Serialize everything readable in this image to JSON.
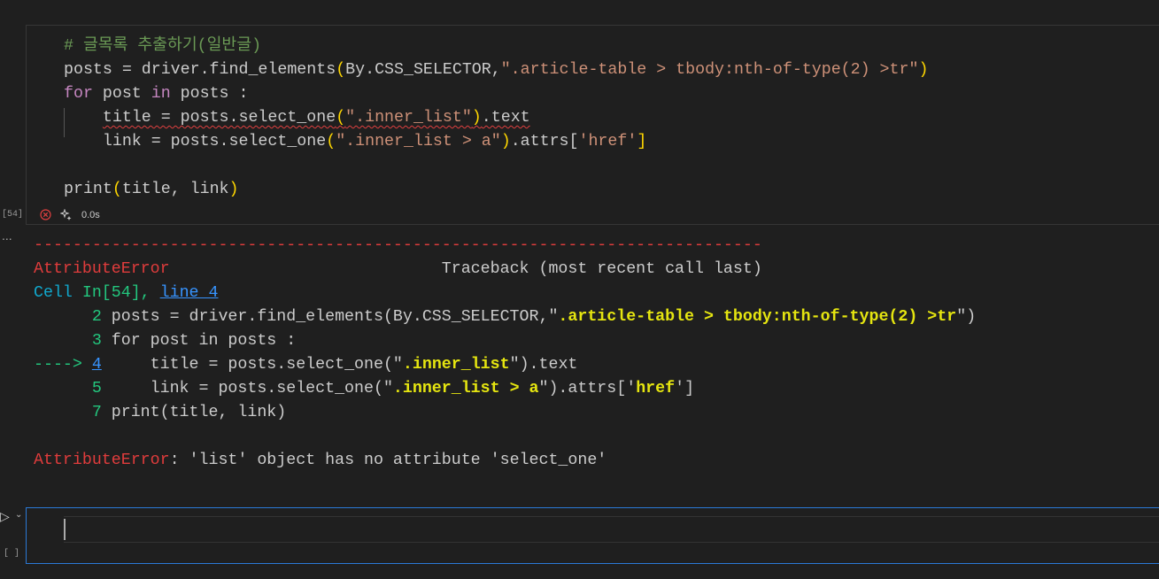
{
  "cell": {
    "execution_count": "[54]",
    "status_icon": "error-circle-icon",
    "timer_icon": "sparkle-icon",
    "duration": "0.0s",
    "code_lines": [
      [
        {
          "t": "# 글목록 추출하기(일반글)",
          "c": "c-com"
        }
      ],
      [
        {
          "t": "posts = driver.find_elements",
          "c": "c-plain"
        },
        {
          "t": "(",
          "c": "c-par"
        },
        {
          "t": "By.CSS_SELECTOR,",
          "c": "c-plain"
        },
        {
          "t": "\".article-table > tbody:nth-of-type(2) >tr\"",
          "c": "c-str"
        },
        {
          "t": ")",
          "c": "c-par"
        }
      ],
      [
        {
          "t": "for",
          "c": "c-kw"
        },
        {
          "t": " post ",
          "c": "c-plain"
        },
        {
          "t": "in",
          "c": "c-kw"
        },
        {
          "t": " posts :",
          "c": "c-plain"
        }
      ],
      [
        {
          "t": "    ",
          "c": "c-plain"
        },
        {
          "t": "title = posts.select_one",
          "c": "c-plain squiggle"
        },
        {
          "t": "(",
          "c": "c-par squiggle"
        },
        {
          "t": "\".inner_list\"",
          "c": "c-str squiggle"
        },
        {
          "t": ")",
          "c": "c-par squiggle"
        },
        {
          "t": ".text",
          "c": "c-plain squiggle"
        }
      ],
      [
        {
          "t": "    link = posts.select_one",
          "c": "c-plain"
        },
        {
          "t": "(",
          "c": "c-par"
        },
        {
          "t": "\".inner_list > a\"",
          "c": "c-str"
        },
        {
          "t": ")",
          "c": "c-par"
        },
        {
          "t": ".attrs[",
          "c": "c-plain"
        },
        {
          "t": "'href'",
          "c": "c-str"
        },
        {
          "t": "]",
          "c": "c-par"
        }
      ],
      [
        {
          "t": "",
          "c": "c-plain"
        }
      ],
      [
        {
          "t": "print",
          "c": "c-plain"
        },
        {
          "t": "(",
          "c": "c-par"
        },
        {
          "t": "title, link",
          "c": "c-plain"
        },
        {
          "t": ")",
          "c": "c-par"
        }
      ]
    ]
  },
  "output": {
    "more_icon": "...",
    "lines": [
      [
        {
          "t": "---------------------------------------------------------------------------",
          "c": "o-red"
        }
      ],
      [
        {
          "t": "AttributeError",
          "c": "o-red"
        },
        {
          "t": "                            Traceback (most recent call last)",
          "c": "o-plain"
        }
      ],
      [
        {
          "t": "Cell",
          "c": "o-cyan"
        },
        {
          "t": " In[54], ",
          "c": "o-green"
        },
        {
          "t": "line 4",
          "c": "o-link"
        }
      ],
      [
        {
          "t": "      2",
          "c": "o-green"
        },
        {
          "t": " posts = driver.find_elements(By.CSS_SELECTOR,\"",
          "c": "o-plain"
        },
        {
          "t": ".article-table > tbody:nth-of-type(2) >tr",
          "c": "o-yel"
        },
        {
          "t": "\")",
          "c": "o-plain"
        }
      ],
      [
        {
          "t": "      3",
          "c": "o-green"
        },
        {
          "t": " for post in posts :",
          "c": "o-plain"
        }
      ],
      [
        {
          "t": "----> ",
          "c": "o-green"
        },
        {
          "t": "4",
          "c": "o-link"
        },
        {
          "t": "     title = posts.select_one(\"",
          "c": "o-plain"
        },
        {
          "t": ".inner_list",
          "c": "o-yel"
        },
        {
          "t": "\").text",
          "c": "o-plain"
        }
      ],
      [
        {
          "t": "      5",
          "c": "o-green"
        },
        {
          "t": "     link = posts.select_one(\"",
          "c": "o-plain"
        },
        {
          "t": ".inner_list > a",
          "c": "o-yel"
        },
        {
          "t": "\").attrs['",
          "c": "o-plain"
        },
        {
          "t": "href",
          "c": "o-yel"
        },
        {
          "t": "']",
          "c": "o-plain"
        }
      ],
      [
        {
          "t": "      7",
          "c": "o-green"
        },
        {
          "t": " print(title, link)",
          "c": "o-plain"
        }
      ],
      [
        {
          "t": "",
          "c": "o-plain"
        }
      ],
      [
        {
          "t": "AttributeError",
          "c": "o-red"
        },
        {
          "t": ": 'list' object has no attribute 'select_one'",
          "c": "o-plain"
        }
      ]
    ]
  },
  "new_cell": {
    "run_icon": "run-triangle-icon",
    "chevron_icon": "chevron-down-icon",
    "execution_count": "[ ]"
  },
  "colors": {
    "background": "#1f1f1f",
    "focus_border": "#2b79d6",
    "error": "#e03c3c"
  }
}
